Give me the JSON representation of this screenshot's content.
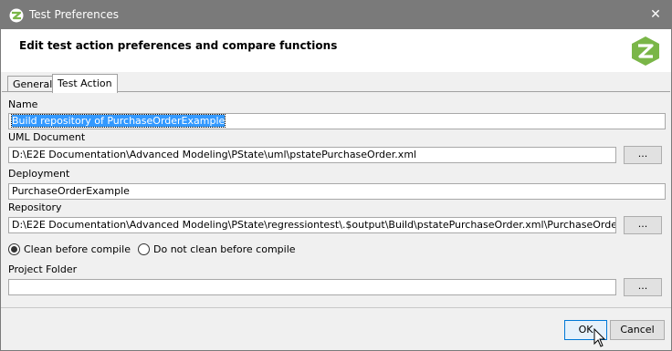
{
  "window": {
    "title": "Test Preferences",
    "close_glyph": "✕"
  },
  "header": {
    "heading": "Edit test action preferences and compare functions",
    "logo_icon": "e2e-logo-icon"
  },
  "tabs": [
    {
      "label": "General",
      "active": false
    },
    {
      "label": "Test Action",
      "active": true
    }
  ],
  "form": {
    "name_label": "Name",
    "name_value": "Build repository of PurchaseOrderExample",
    "uml_label": "UML Document",
    "uml_value": "D:\\E2E Documentation\\Advanced Modeling\\PState\\uml\\pstatePurchaseOrder.xml",
    "deployment_label": "Deployment",
    "deployment_value": "PurchaseOrderExample",
    "repository_label": "Repository",
    "repository_value": "D:\\E2E Documentation\\Advanced Modeling\\PState\\regressiontest\\.$output\\Build\\pstatePurchaseOrder.xml\\PurchaseOrderExample.rep",
    "browse_label": "...",
    "radio_clean": "Clean before compile",
    "radio_noclean": "Do not clean before compile",
    "clean_selected": true,
    "project_folder_label": "Project Folder",
    "project_folder_value": ""
  },
  "footer": {
    "ok_label": "OK",
    "cancel_label": "Cancel"
  },
  "colors": {
    "titlebar": "#7a7a7a",
    "selection": "#3399ff",
    "logo_green": "#7ab648"
  }
}
